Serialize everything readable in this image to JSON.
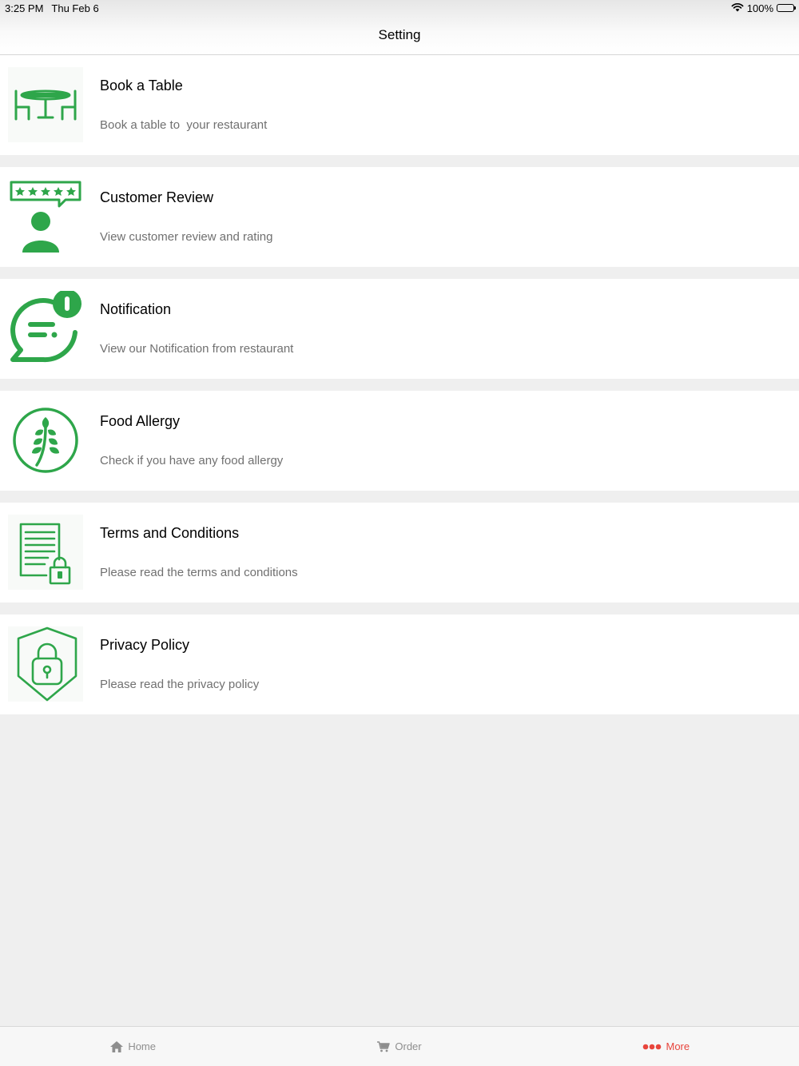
{
  "status_bar": {
    "time": "3:25 PM",
    "date": "Thu Feb 6",
    "battery": "100%"
  },
  "nav": {
    "title": "Setting"
  },
  "colors": {
    "accent_green": "#2ea64a",
    "tab_active": "#e8453c",
    "tab_inactive": "#8e8e8e"
  },
  "items": [
    {
      "icon": "dining-table-icon",
      "title": "Book a Table",
      "subtitle": "Book a table to  your restaurant"
    },
    {
      "icon": "customer-review-icon",
      "title": "Customer Review",
      "subtitle": "View customer review and rating"
    },
    {
      "icon": "notification-chat-icon",
      "title": "Notification",
      "subtitle": "View our Notification from restaurant"
    },
    {
      "icon": "wheat-allergy-icon",
      "title": "Food Allergy",
      "subtitle": "Check if you have any food allergy"
    },
    {
      "icon": "document-lock-icon",
      "title": "Terms and Conditions",
      "subtitle": "Please read the terms and conditions"
    },
    {
      "icon": "shield-lock-icon",
      "title": "Privacy Policy",
      "subtitle": "Please read the privacy policy"
    }
  ],
  "tabs": [
    {
      "icon": "home-icon",
      "label": "Home"
    },
    {
      "icon": "cart-icon",
      "label": "Order"
    },
    {
      "icon": "more-dots-icon",
      "label": "More"
    }
  ]
}
